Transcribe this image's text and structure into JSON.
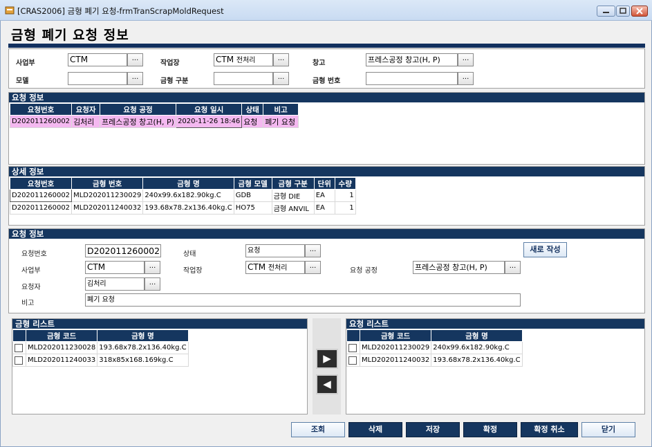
{
  "window": {
    "title": "[CRAS2006] 금형 폐기 요청-frmTranScrapMoldRequest"
  },
  "page_title": "금형 폐기 요청 정보",
  "filter": {
    "business_label": "사업부",
    "business_value": "CTM",
    "workplace_label": "작업장",
    "workplace_value": "CTM",
    "workplace_value_sub": "전처리",
    "warehouse_label": "창고",
    "warehouse_value": "프레스공정 창고(H, P)",
    "model_label": "모델",
    "model_value": "",
    "mold_type_label": "금형 구분",
    "mold_type_value": "",
    "mold_no_label": "금형 번호",
    "mold_no_value": "",
    "dots": "..."
  },
  "request_grid": {
    "header": "요청 정보",
    "columns": [
      "요청번호",
      "요청자",
      "요청 공정",
      "요청 일시",
      "상태",
      "비고"
    ],
    "rows": [
      [
        "D202011260002",
        "김처리",
        "프레스공정 창고(H, P)",
        "2020-11-26 18:46",
        "요청",
        "폐기 요청"
      ]
    ]
  },
  "detail_grid": {
    "header": "상세 정보",
    "columns": [
      "요청번호",
      "금형 번호",
      "금형 명",
      "금형 모델",
      "금형 구분",
      "단위",
      "수량"
    ],
    "rows": [
      [
        "D202011260002",
        "MLD202011230029",
        "240x99.6x182.90kg.C",
        "GDB",
        "금형 DIE",
        "EA",
        "1"
      ],
      [
        "D202011260002",
        "MLD202011240032",
        "193.68x78.2x136.40kg.C",
        "HO75",
        "금형 ANVIL",
        "EA",
        "1"
      ]
    ]
  },
  "form": {
    "header": "요청 정보",
    "req_no_label": "요청번호",
    "req_no_value": "D202011260002",
    "status_label": "상태",
    "status_value": "요청",
    "new_button": "새로 작성",
    "business_label": "사업부",
    "business_value": "CTM",
    "workplace_label": "작업장",
    "workplace_value": "CTM",
    "workplace_value_sub": "전처리",
    "process_label": "요청 공정",
    "process_value": "프레스공정 창고(H, P)",
    "requester_label": "요청자",
    "requester_value": "김처리",
    "note_label": "비고",
    "note_value": "폐기 요청"
  },
  "mold_list": {
    "header": "금형 리스트",
    "columns": [
      "금형 코드",
      "금형 명"
    ],
    "rows": [
      [
        "MLD202011230028",
        "193.68x78.2x136.40kg.C"
      ],
      [
        "MLD202011240033",
        "318x85x168.169kg.C"
      ]
    ]
  },
  "request_list": {
    "header": "요청 리스트",
    "columns": [
      "금형 코드",
      "금형 명"
    ],
    "rows": [
      [
        "MLD202011230029",
        "240x99.6x182.90kg.C"
      ],
      [
        "MLD202011240032",
        "193.68x78.2x136.40kg.C"
      ]
    ]
  },
  "arrows": {
    "right": "▶",
    "left": "◀"
  },
  "buttons": {
    "search": "조회",
    "delete": "삭제",
    "save": "저장",
    "confirm": "확정",
    "cancel_confirm": "확정 취소",
    "close": "닫기"
  },
  "colors": {
    "navy": "#15365f",
    "selected_row": "#f4b8f0"
  }
}
